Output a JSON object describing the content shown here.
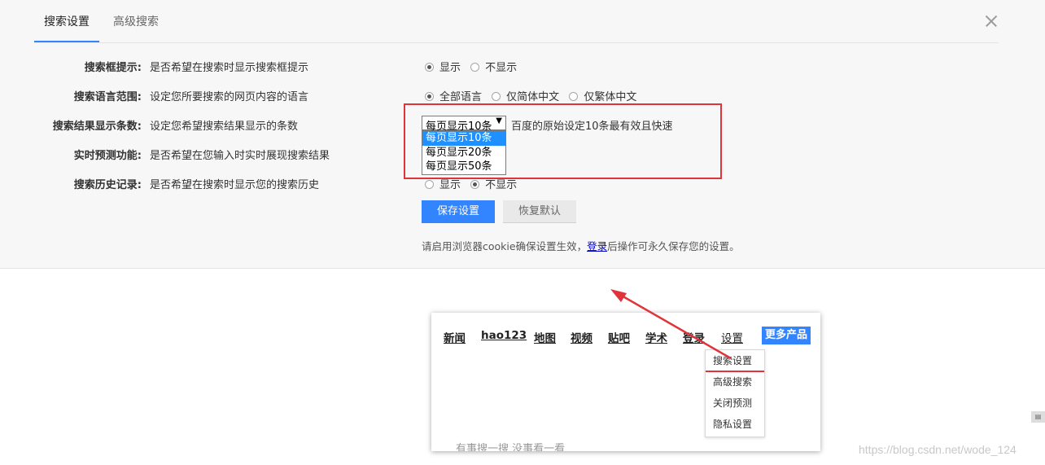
{
  "tabs": {
    "active": "搜索设置",
    "second": "高级搜索"
  },
  "settings": [
    {
      "label": "搜索框提示:",
      "desc": "是否希望在搜索时显示搜索框提示",
      "options": [
        {
          "text": "显示",
          "checked": true
        },
        {
          "text": "不显示",
          "checked": false
        }
      ]
    },
    {
      "label": "搜索语言范围:",
      "desc": "设定您所要搜索的网页内容的语言",
      "options": [
        {
          "text": "全部语言",
          "checked": true
        },
        {
          "text": "仅简体中文",
          "checked": false
        },
        {
          "text": "仅繁体中文",
          "checked": false
        }
      ]
    },
    {
      "label": "搜索结果显示条数:",
      "desc": "设定您希望搜索结果显示的条数"
    },
    {
      "label": "实时预测功能:",
      "desc": "是否希望在您输入时实时展现搜索结果"
    },
    {
      "label": "搜索历史记录:",
      "desc": "是否希望在搜索时显示您的搜索历史",
      "options": [
        {
          "text": "显示",
          "checked": false
        },
        {
          "text": "不显示",
          "checked": true
        }
      ]
    }
  ],
  "results_select": {
    "value": "每页显示10条",
    "hint": "百度的原始设定10条最有效且快速",
    "options": [
      "每页显示10条",
      "每页显示20条",
      "每页显示50条"
    ],
    "selected_index": 0
  },
  "buttons": {
    "save": "保存设置",
    "reset": "恢复默认"
  },
  "note": {
    "before": "请启用浏览器cookie确保设置生效，",
    "link": "登录",
    "after": "后操作可永久保存您的设置。"
  },
  "inset": {
    "nav": [
      "新闻",
      "hao123",
      "地图",
      "视频",
      "贴吧",
      "学术",
      "登录",
      "设置"
    ],
    "more": "更多产品",
    "submenu": [
      "搜索设置",
      "高级搜索",
      "关闭预测",
      "隐私设置"
    ],
    "bottom_ghost": "有事搜一搜  没事看一看"
  },
  "watermark": "https://blog.csdn.net/wode_124",
  "colors": {
    "accent": "#3385ff",
    "highlight_red": "#e0333a",
    "panel_bg": "#f7f7f7"
  }
}
